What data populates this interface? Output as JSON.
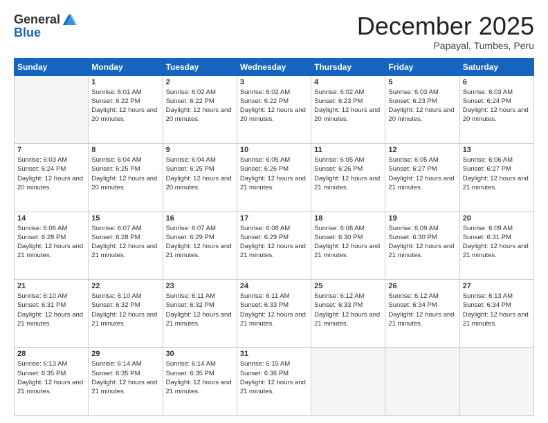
{
  "header": {
    "logo_general": "General",
    "logo_blue": "Blue",
    "month_title": "December 2025",
    "subtitle": "Papayal, Tumbes, Peru"
  },
  "days_of_week": [
    "Sunday",
    "Monday",
    "Tuesday",
    "Wednesday",
    "Thursday",
    "Friday",
    "Saturday"
  ],
  "weeks": [
    [
      {
        "day": "",
        "sunrise": "",
        "sunset": "",
        "daylight": ""
      },
      {
        "day": "1",
        "sunrise": "Sunrise: 6:01 AM",
        "sunset": "Sunset: 6:22 PM",
        "daylight": "Daylight: 12 hours and 20 minutes."
      },
      {
        "day": "2",
        "sunrise": "Sunrise: 6:02 AM",
        "sunset": "Sunset: 6:22 PM",
        "daylight": "Daylight: 12 hours and 20 minutes."
      },
      {
        "day": "3",
        "sunrise": "Sunrise: 6:02 AM",
        "sunset": "Sunset: 6:22 PM",
        "daylight": "Daylight: 12 hours and 20 minutes."
      },
      {
        "day": "4",
        "sunrise": "Sunrise: 6:02 AM",
        "sunset": "Sunset: 6:23 PM",
        "daylight": "Daylight: 12 hours and 20 minutes."
      },
      {
        "day": "5",
        "sunrise": "Sunrise: 6:03 AM",
        "sunset": "Sunset: 6:23 PM",
        "daylight": "Daylight: 12 hours and 20 minutes."
      },
      {
        "day": "6",
        "sunrise": "Sunrise: 6:03 AM",
        "sunset": "Sunset: 6:24 PM",
        "daylight": "Daylight: 12 hours and 20 minutes."
      }
    ],
    [
      {
        "day": "7",
        "sunrise": "Sunrise: 6:03 AM",
        "sunset": "Sunset: 6:24 PM",
        "daylight": "Daylight: 12 hours and 20 minutes."
      },
      {
        "day": "8",
        "sunrise": "Sunrise: 6:04 AM",
        "sunset": "Sunset: 6:25 PM",
        "daylight": "Daylight: 12 hours and 20 minutes."
      },
      {
        "day": "9",
        "sunrise": "Sunrise: 6:04 AM",
        "sunset": "Sunset: 6:25 PM",
        "daylight": "Daylight: 12 hours and 20 minutes."
      },
      {
        "day": "10",
        "sunrise": "Sunrise: 6:05 AM",
        "sunset": "Sunset: 6:26 PM",
        "daylight": "Daylight: 12 hours and 21 minutes."
      },
      {
        "day": "11",
        "sunrise": "Sunrise: 6:05 AM",
        "sunset": "Sunset: 6:26 PM",
        "daylight": "Daylight: 12 hours and 21 minutes."
      },
      {
        "day": "12",
        "sunrise": "Sunrise: 6:05 AM",
        "sunset": "Sunset: 6:27 PM",
        "daylight": "Daylight: 12 hours and 21 minutes."
      },
      {
        "day": "13",
        "sunrise": "Sunrise: 6:06 AM",
        "sunset": "Sunset: 6:27 PM",
        "daylight": "Daylight: 12 hours and 21 minutes."
      }
    ],
    [
      {
        "day": "14",
        "sunrise": "Sunrise: 6:06 AM",
        "sunset": "Sunset: 6:28 PM",
        "daylight": "Daylight: 12 hours and 21 minutes."
      },
      {
        "day": "15",
        "sunrise": "Sunrise: 6:07 AM",
        "sunset": "Sunset: 6:28 PM",
        "daylight": "Daylight: 12 hours and 21 minutes."
      },
      {
        "day": "16",
        "sunrise": "Sunrise: 6:07 AM",
        "sunset": "Sunset: 6:29 PM",
        "daylight": "Daylight: 12 hours and 21 minutes."
      },
      {
        "day": "17",
        "sunrise": "Sunrise: 6:08 AM",
        "sunset": "Sunset: 6:29 PM",
        "daylight": "Daylight: 12 hours and 21 minutes."
      },
      {
        "day": "18",
        "sunrise": "Sunrise: 6:08 AM",
        "sunset": "Sunset: 6:30 PM",
        "daylight": "Daylight: 12 hours and 21 minutes."
      },
      {
        "day": "19",
        "sunrise": "Sunrise: 6:09 AM",
        "sunset": "Sunset: 6:30 PM",
        "daylight": "Daylight: 12 hours and 21 minutes."
      },
      {
        "day": "20",
        "sunrise": "Sunrise: 6:09 AM",
        "sunset": "Sunset: 6:31 PM",
        "daylight": "Daylight: 12 hours and 21 minutes."
      }
    ],
    [
      {
        "day": "21",
        "sunrise": "Sunrise: 6:10 AM",
        "sunset": "Sunset: 6:31 PM",
        "daylight": "Daylight: 12 hours and 21 minutes."
      },
      {
        "day": "22",
        "sunrise": "Sunrise: 6:10 AM",
        "sunset": "Sunset: 6:32 PM",
        "daylight": "Daylight: 12 hours and 21 minutes."
      },
      {
        "day": "23",
        "sunrise": "Sunrise: 6:11 AM",
        "sunset": "Sunset: 6:32 PM",
        "daylight": "Daylight: 12 hours and 21 minutes."
      },
      {
        "day": "24",
        "sunrise": "Sunrise: 6:11 AM",
        "sunset": "Sunset: 6:33 PM",
        "daylight": "Daylight: 12 hours and 21 minutes."
      },
      {
        "day": "25",
        "sunrise": "Sunrise: 6:12 AM",
        "sunset": "Sunset: 6:33 PM",
        "daylight": "Daylight: 12 hours and 21 minutes."
      },
      {
        "day": "26",
        "sunrise": "Sunrise: 6:12 AM",
        "sunset": "Sunset: 6:34 PM",
        "daylight": "Daylight: 12 hours and 21 minutes."
      },
      {
        "day": "27",
        "sunrise": "Sunrise: 6:13 AM",
        "sunset": "Sunset: 6:34 PM",
        "daylight": "Daylight: 12 hours and 21 minutes."
      }
    ],
    [
      {
        "day": "28",
        "sunrise": "Sunrise: 6:13 AM",
        "sunset": "Sunset: 6:35 PM",
        "daylight": "Daylight: 12 hours and 21 minutes."
      },
      {
        "day": "29",
        "sunrise": "Sunrise: 6:14 AM",
        "sunset": "Sunset: 6:35 PM",
        "daylight": "Daylight: 12 hours and 21 minutes."
      },
      {
        "day": "30",
        "sunrise": "Sunrise: 6:14 AM",
        "sunset": "Sunset: 6:35 PM",
        "daylight": "Daylight: 12 hours and 21 minutes."
      },
      {
        "day": "31",
        "sunrise": "Sunrise: 6:15 AM",
        "sunset": "Sunset: 6:36 PM",
        "daylight": "Daylight: 12 hours and 21 minutes."
      },
      {
        "day": "",
        "sunrise": "",
        "sunset": "",
        "daylight": ""
      },
      {
        "day": "",
        "sunrise": "",
        "sunset": "",
        "daylight": ""
      },
      {
        "day": "",
        "sunrise": "",
        "sunset": "",
        "daylight": ""
      }
    ]
  ]
}
